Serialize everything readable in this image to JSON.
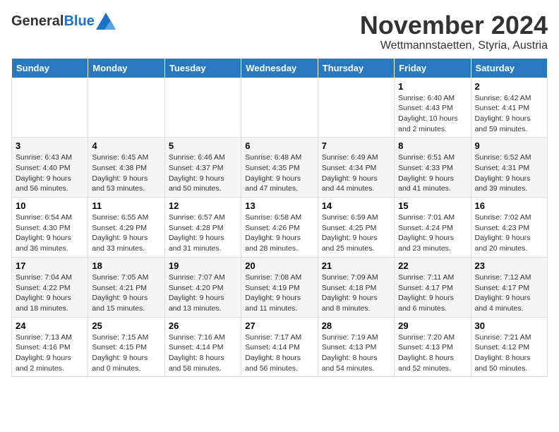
{
  "header": {
    "logo_general": "General",
    "logo_blue": "Blue",
    "month": "November 2024",
    "location": "Wettmannstaetten, Styria, Austria"
  },
  "days_of_week": [
    "Sunday",
    "Monday",
    "Tuesday",
    "Wednesday",
    "Thursday",
    "Friday",
    "Saturday"
  ],
  "weeks": [
    [
      {
        "day": "",
        "info": ""
      },
      {
        "day": "",
        "info": ""
      },
      {
        "day": "",
        "info": ""
      },
      {
        "day": "",
        "info": ""
      },
      {
        "day": "",
        "info": ""
      },
      {
        "day": "1",
        "info": "Sunrise: 6:40 AM\nSunset: 4:43 PM\nDaylight: 10 hours\nand 2 minutes."
      },
      {
        "day": "2",
        "info": "Sunrise: 6:42 AM\nSunset: 4:41 PM\nDaylight: 9 hours\nand 59 minutes."
      }
    ],
    [
      {
        "day": "3",
        "info": "Sunrise: 6:43 AM\nSunset: 4:40 PM\nDaylight: 9 hours\nand 56 minutes."
      },
      {
        "day": "4",
        "info": "Sunrise: 6:45 AM\nSunset: 4:38 PM\nDaylight: 9 hours\nand 53 minutes."
      },
      {
        "day": "5",
        "info": "Sunrise: 6:46 AM\nSunset: 4:37 PM\nDaylight: 9 hours\nand 50 minutes."
      },
      {
        "day": "6",
        "info": "Sunrise: 6:48 AM\nSunset: 4:35 PM\nDaylight: 9 hours\nand 47 minutes."
      },
      {
        "day": "7",
        "info": "Sunrise: 6:49 AM\nSunset: 4:34 PM\nDaylight: 9 hours\nand 44 minutes."
      },
      {
        "day": "8",
        "info": "Sunrise: 6:51 AM\nSunset: 4:33 PM\nDaylight: 9 hours\nand 41 minutes."
      },
      {
        "day": "9",
        "info": "Sunrise: 6:52 AM\nSunset: 4:31 PM\nDaylight: 9 hours\nand 39 minutes."
      }
    ],
    [
      {
        "day": "10",
        "info": "Sunrise: 6:54 AM\nSunset: 4:30 PM\nDaylight: 9 hours\nand 36 minutes."
      },
      {
        "day": "11",
        "info": "Sunrise: 6:55 AM\nSunset: 4:29 PM\nDaylight: 9 hours\nand 33 minutes."
      },
      {
        "day": "12",
        "info": "Sunrise: 6:57 AM\nSunset: 4:28 PM\nDaylight: 9 hours\nand 31 minutes."
      },
      {
        "day": "13",
        "info": "Sunrise: 6:58 AM\nSunset: 4:26 PM\nDaylight: 9 hours\nand 28 minutes."
      },
      {
        "day": "14",
        "info": "Sunrise: 6:59 AM\nSunset: 4:25 PM\nDaylight: 9 hours\nand 25 minutes."
      },
      {
        "day": "15",
        "info": "Sunrise: 7:01 AM\nSunset: 4:24 PM\nDaylight: 9 hours\nand 23 minutes."
      },
      {
        "day": "16",
        "info": "Sunrise: 7:02 AM\nSunset: 4:23 PM\nDaylight: 9 hours\nand 20 minutes."
      }
    ],
    [
      {
        "day": "17",
        "info": "Sunrise: 7:04 AM\nSunset: 4:22 PM\nDaylight: 9 hours\nand 18 minutes."
      },
      {
        "day": "18",
        "info": "Sunrise: 7:05 AM\nSunset: 4:21 PM\nDaylight: 9 hours\nand 15 minutes."
      },
      {
        "day": "19",
        "info": "Sunrise: 7:07 AM\nSunset: 4:20 PM\nDaylight: 9 hours\nand 13 minutes."
      },
      {
        "day": "20",
        "info": "Sunrise: 7:08 AM\nSunset: 4:19 PM\nDaylight: 9 hours\nand 11 minutes."
      },
      {
        "day": "21",
        "info": "Sunrise: 7:09 AM\nSunset: 4:18 PM\nDaylight: 9 hours\nand 8 minutes."
      },
      {
        "day": "22",
        "info": "Sunrise: 7:11 AM\nSunset: 4:17 PM\nDaylight: 9 hours\nand 6 minutes."
      },
      {
        "day": "23",
        "info": "Sunrise: 7:12 AM\nSunset: 4:17 PM\nDaylight: 9 hours\nand 4 minutes."
      }
    ],
    [
      {
        "day": "24",
        "info": "Sunrise: 7:13 AM\nSunset: 4:16 PM\nDaylight: 9 hours\nand 2 minutes."
      },
      {
        "day": "25",
        "info": "Sunrise: 7:15 AM\nSunset: 4:15 PM\nDaylight: 9 hours\nand 0 minutes."
      },
      {
        "day": "26",
        "info": "Sunrise: 7:16 AM\nSunset: 4:14 PM\nDaylight: 8 hours\nand 58 minutes."
      },
      {
        "day": "27",
        "info": "Sunrise: 7:17 AM\nSunset: 4:14 PM\nDaylight: 8 hours\nand 56 minutes."
      },
      {
        "day": "28",
        "info": "Sunrise: 7:19 AM\nSunset: 4:13 PM\nDaylight: 8 hours\nand 54 minutes."
      },
      {
        "day": "29",
        "info": "Sunrise: 7:20 AM\nSunset: 4:13 PM\nDaylight: 8 hours\nand 52 minutes."
      },
      {
        "day": "30",
        "info": "Sunrise: 7:21 AM\nSunset: 4:12 PM\nDaylight: 8 hours\nand 50 minutes."
      }
    ]
  ]
}
